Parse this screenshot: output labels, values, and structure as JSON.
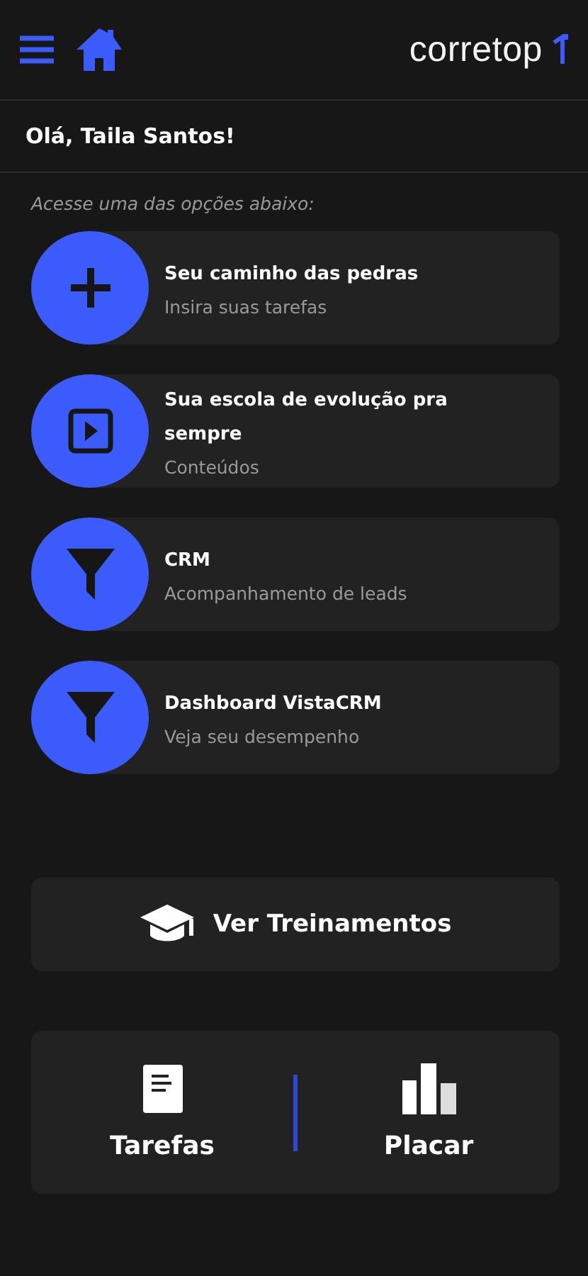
{
  "header": {
    "logo": "corretop"
  },
  "greeting": "Olá, Taila Santos!",
  "prompt": "Acesse uma das opções abaixo:",
  "options": [
    {
      "kind": "plus",
      "title": "Seu caminho das pedras",
      "subtitle": "Insira suas tarefas"
    },
    {
      "kind": "play",
      "title": "Sua escola de evolução pra sempre",
      "subtitle": "Conteúdos"
    },
    {
      "kind": "filter",
      "title": "CRM",
      "subtitle": "Acompanhamento de leads"
    },
    {
      "kind": "filter",
      "title": "Dashboard VistaCRM",
      "subtitle": "Veja seu desempenho"
    }
  ],
  "training_button": "Ver Treinamentos",
  "bottom_actions": [
    {
      "kind": "tasks",
      "label": "Tarefas"
    },
    {
      "kind": "scoreboard",
      "label": "Placar"
    }
  ]
}
